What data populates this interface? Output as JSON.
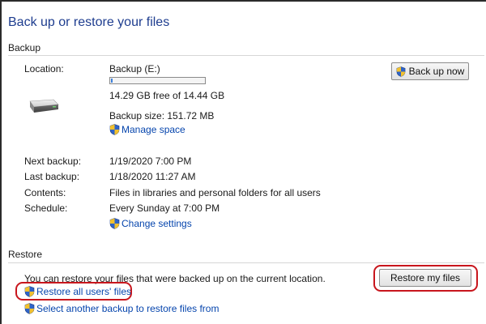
{
  "page": {
    "title": "Back up or restore your files"
  },
  "backup": {
    "section_title": "Backup",
    "location_label": "Location:",
    "location_value": "Backup (E:)",
    "free_space_text": "14.29 GB free of 14.44 GB",
    "disk_used_fraction": 0.01,
    "backup_size_text": "Backup size: 151.72 MB",
    "manage_space_link": "Manage space",
    "back_up_now_button": "Back up now",
    "next_backup_label": "Next backup:",
    "next_backup_value": "1/19/2020 7:00 PM",
    "last_backup_label": "Last backup:",
    "last_backup_value": "1/18/2020 11:27 AM",
    "contents_label": "Contents:",
    "contents_value": "Files in libraries and personal folders for all users",
    "schedule_label": "Schedule:",
    "schedule_value": "Every Sunday at 7:00 PM",
    "change_settings_link": "Change settings"
  },
  "restore": {
    "section_title": "Restore",
    "description": "You can restore your files that were backed up on the current location.",
    "restore_my_files_button": "Restore my files",
    "restore_all_users_link": "Restore all users' files",
    "select_another_backup_link": "Select another backup to restore files from"
  },
  "icons": {
    "shield": "uac-shield-icon",
    "drive": "hard-drive-icon"
  },
  "colors": {
    "title": "#1e3d8f",
    "link": "#0645ad",
    "highlight": "#c8161d",
    "progress": "#3c7fd8"
  }
}
